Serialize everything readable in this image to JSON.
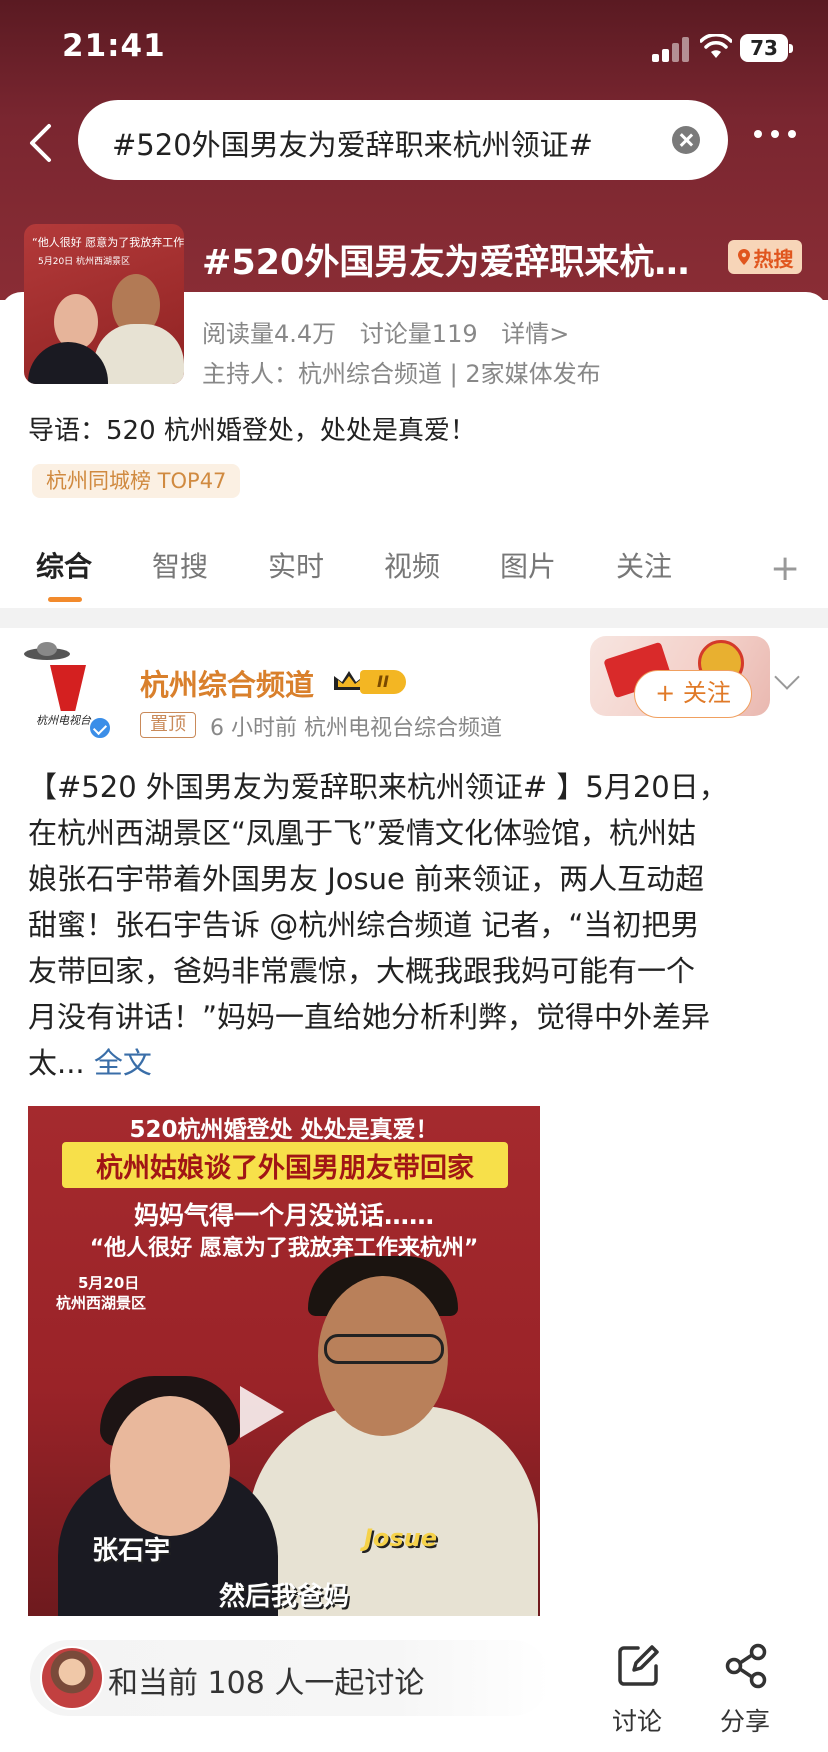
{
  "status_bar": {
    "time": "21:41",
    "battery": "73"
  },
  "search": {
    "query": "#520外国男友为爱辞职来杭州领证#"
  },
  "topic": {
    "title": "#520外国男友为爱辞职来杭…",
    "hot_badge": "热搜",
    "reads": "阅读量4.4万",
    "discussions": "讨论量119",
    "details": "详情>",
    "host": "主持人：杭州综合频道 | 2家媒体发布",
    "intro": "导语：520 杭州婚登处，处处是真爱！",
    "rank_tag": "杭州同城榜 TOP47",
    "thumb_caption": "“他人很好 愿意为了我放弃工作来杭州”",
    "thumb_sub": "5月20日 杭州西湖景区"
  },
  "tabs": [
    {
      "label": "综合",
      "active": true
    },
    {
      "label": "智搜"
    },
    {
      "label": "实时"
    },
    {
      "label": "视频"
    },
    {
      "label": "图片"
    },
    {
      "label": "关注"
    }
  ],
  "post": {
    "author": "杭州综合频道",
    "level": "II",
    "pinned_label": "置顶",
    "meta": "6 小时前   杭州电视台综合频道",
    "avatar_caption": "杭州电视台",
    "follow_label": "+ 关注",
    "body_lines": [
      "【#520 外国男友为爱辞职来杭州领证# 】5月20日，",
      "在杭州西湖景区“凤凰于飞”爱情文化体验馆，杭州姑",
      "娘张石宇带着外国男友 Josue 前来领证，两人互动超",
      "甜蜜！张石宇告诉 @杭州综合频道 记者，“当初把男",
      "友带回家，爸妈非常震惊，大概我跟我妈可能有一个",
      "月没有讲话！”妈妈一直给她分析利弊，觉得中外差异",
      "太..."
    ],
    "full_text_link": "全文",
    "video": {
      "line1": "520杭州婚登处 处处是真爱！",
      "line2": "杭州姑娘谈了外国男朋友带回家",
      "line3": "妈妈气得一个月没说话……",
      "line4": "“他人很好 愿意为了我放弃工作来杭州”",
      "date": "5月20日",
      "place": "杭州西湖景区",
      "name_female": "张石宇",
      "name_male": "Josue",
      "subtitle": "然后我爸妈"
    }
  },
  "bottom_bar": {
    "discuss_prompt": "和当前 108 人一起讨论",
    "discuss_label": "讨论",
    "share_label": "分享"
  },
  "colors": {
    "header": "#7a2630",
    "accent_orange": "#f28a2c",
    "author": "#d9802c",
    "link": "#3a6ea8"
  }
}
